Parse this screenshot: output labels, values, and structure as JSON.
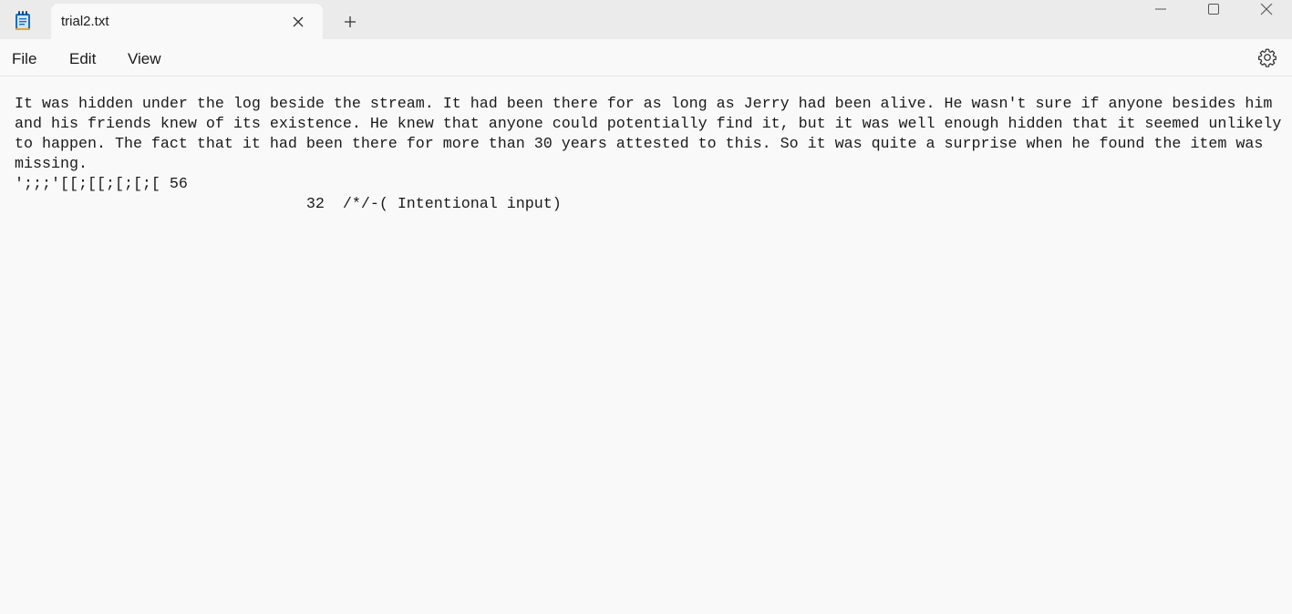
{
  "tab": {
    "title": "trial2.txt",
    "close_icon": "close-icon",
    "new_tab_icon": "plus-icon"
  },
  "app_icon": "notepad-icon",
  "window_controls": {
    "minimize_icon": "minimize-icon",
    "maximize_icon": "maximize-icon",
    "close_icon": "close-icon"
  },
  "menu": {
    "file": "File",
    "edit": "Edit",
    "view": "View",
    "settings_icon": "gear-icon"
  },
  "editor": {
    "content": "It was hidden under the log beside the stream. It had been there for as long as Jerry had been alive. He wasn't sure if anyone besides him and his friends knew of its existence. He knew that anyone could potentially find it, but it was well enough hidden that it seemed unlikely to happen. The fact that it had been there for more than 30 years attested to this. So it was quite a surprise when he found the item was missing.\n';;;'[[;[[;[;[;[ 56\n\t\t\t\t32  /*/-( Intentional input)"
  },
  "colors": {
    "titlebar_bg": "#ebebeb",
    "editor_bg": "#f9f9f9",
    "text": "#1a1a1a",
    "app_icon_blue": "#1e6fb8"
  }
}
